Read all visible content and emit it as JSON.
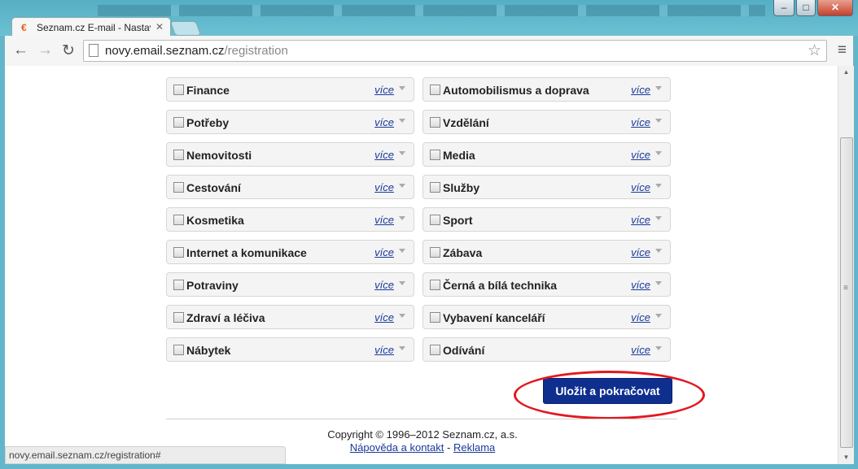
{
  "browser": {
    "tab_title": "Seznam.cz E-mail - Nastav",
    "url_host": "novy.email.seznam.cz",
    "url_path": "/registration",
    "status_url": "novy.email.seznam.cz/registration#"
  },
  "categories": [
    {
      "label": "Finance",
      "more": "více"
    },
    {
      "label": "Automobilismus a doprava",
      "more": "více"
    },
    {
      "label": "Potřeby",
      "more": "více"
    },
    {
      "label": "Vzdělání",
      "more": "více"
    },
    {
      "label": "Nemovitosti",
      "more": "více"
    },
    {
      "label": "Media",
      "more": "více"
    },
    {
      "label": "Cestování",
      "more": "více"
    },
    {
      "label": "Služby",
      "more": "více"
    },
    {
      "label": "Kosmetika",
      "more": "více"
    },
    {
      "label": "Sport",
      "more": "více"
    },
    {
      "label": "Internet a komunikace",
      "more": "více"
    },
    {
      "label": "Zábava",
      "more": "více"
    },
    {
      "label": "Potraviny",
      "more": "více"
    },
    {
      "label": "Černá a bílá technika",
      "more": "více"
    },
    {
      "label": "Zdraví a léčiva",
      "more": "více"
    },
    {
      "label": "Vybavení kanceláří",
      "more": "více"
    },
    {
      "label": "Nábytek",
      "more": "více"
    },
    {
      "label": "Odívání",
      "more": "více"
    }
  ],
  "actions": {
    "save_label": "Uložit a pokračovat"
  },
  "footer": {
    "copyright": "Copyright © 1996–2012 Seznam.cz, a.s.",
    "help_link": "Nápověda a kontakt",
    "separator": " - ",
    "ads_link": "Reklama"
  },
  "colors": {
    "button": "#0f2f8f",
    "highlight_ring": "#e3171f",
    "link": "#1a3a9a"
  }
}
